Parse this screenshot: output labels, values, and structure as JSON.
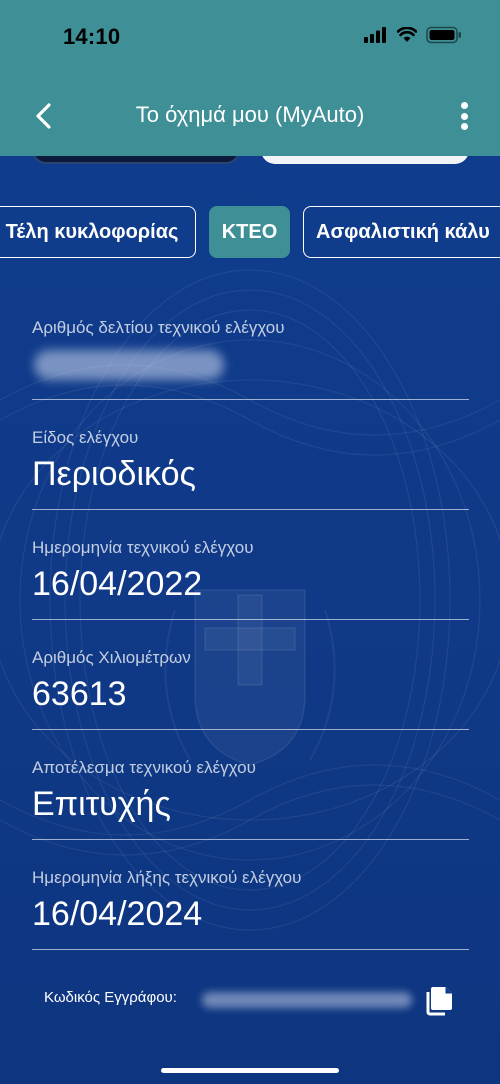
{
  "status_bar": {
    "time": "14:10"
  },
  "nav": {
    "title": "Το όχημά μου (MyAuto)"
  },
  "tabs": [
    {
      "label": "Τέλη κυκλοφορίας",
      "active": false
    },
    {
      "label": "ΚΤΕΟ",
      "active": true
    },
    {
      "label": "Ασφαλιστική κάλυ",
      "active": false
    }
  ],
  "fields": [
    {
      "label": "Αριθμός δελτίου τεχνικού ελέγχου",
      "value": "",
      "redacted": true
    },
    {
      "label": "Είδος ελέγχου",
      "value": "Περιοδικός"
    },
    {
      "label": "Ημερομηνία τεχνικού ελέγχου",
      "value": "16/04/2022"
    },
    {
      "label": "Αριθμός Χιλιομέτρων",
      "value": "63613"
    },
    {
      "label": "Αποτέλεσμα τεχνικού ελέγχου",
      "value": "Επιτυχής"
    },
    {
      "label": "Ημερομηνία λήξης τεχνικού ελέγχου",
      "value": "16/04/2024"
    }
  ],
  "document": {
    "label": "Κωδικός Εγγράφου:",
    "redacted": true
  },
  "colors": {
    "header": "#3e8f96",
    "background": "#0f3b8c",
    "active_tab": "#3e8f96"
  },
  "icons": [
    "back-chevron-icon",
    "more-vertical-icon",
    "signal-icon",
    "wifi-icon",
    "battery-icon",
    "copy-icon"
  ]
}
